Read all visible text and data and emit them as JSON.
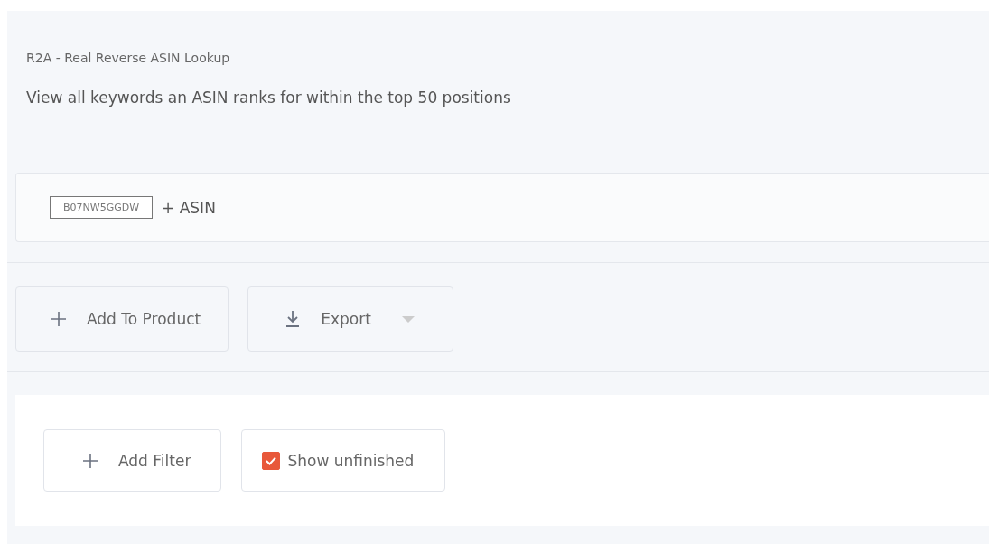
{
  "header": {
    "title": "R2A - Real Reverse ASIN Lookup",
    "subtitle": "View all keywords an ASIN ranks for within the top 50 positions"
  },
  "asin_bar": {
    "asins": [
      "B07NW5GGDW"
    ],
    "add_label": "+ ASIN"
  },
  "actions": [
    {
      "label": "Add To Product",
      "kind": "add"
    },
    {
      "label": "Export",
      "kind": "export"
    }
  ],
  "filters": {
    "add_filter": "Add Filter",
    "show_unfinished": {
      "label": "Show unfinished",
      "checked": true
    }
  }
}
